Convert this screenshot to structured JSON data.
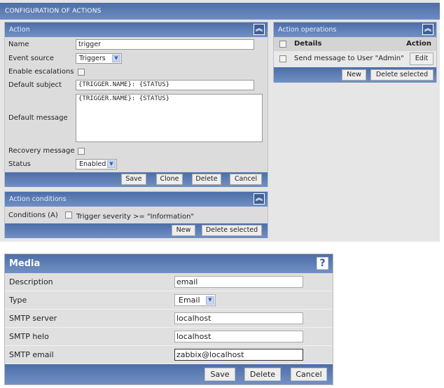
{
  "title": "CONFIGURATION OF ACTIONS",
  "action": {
    "header": "Action",
    "name_label": "Name",
    "name_value": "trigger",
    "event_source_label": "Event source",
    "event_source_value": "Triggers",
    "escalations_label": "Enable escalations",
    "subject_label": "Default subject",
    "subject_value": "{TRIGGER.NAME}: {STATUS}",
    "message_label": "Default message",
    "message_value": "{TRIGGER.NAME}: {STATUS}",
    "recovery_label": "Recovery message",
    "status_label": "Status",
    "status_value": "Enabled",
    "buttons": {
      "save": "Save",
      "clone": "Clone",
      "delete": "Delete",
      "cancel": "Cancel"
    }
  },
  "conditions": {
    "header": "Action conditions",
    "label": "Conditions (A)",
    "condition": "Trigger severity >= \"Information\"",
    "new": "New",
    "delete_selected": "Delete selected"
  },
  "operations": {
    "header": "Action operations",
    "col_details": "Details",
    "col_action": "Action",
    "rows": [
      {
        "details": "Send message to User \"Admin\"",
        "action": "Edit"
      }
    ],
    "new": "New",
    "delete_selected": "Delete selected"
  },
  "media": {
    "header": "Media",
    "help": "?",
    "description_label": "Description",
    "description_value": "email",
    "type_label": "Type",
    "type_value": "Email",
    "server_label": "SMTP server",
    "server_value": "localhost",
    "helo_label": "SMTP helo",
    "helo_value": "localhost",
    "email_label": "SMTP email",
    "email_value": "zabbix@localhost",
    "save": "Save",
    "delete": "Delete",
    "cancel": "Cancel"
  }
}
